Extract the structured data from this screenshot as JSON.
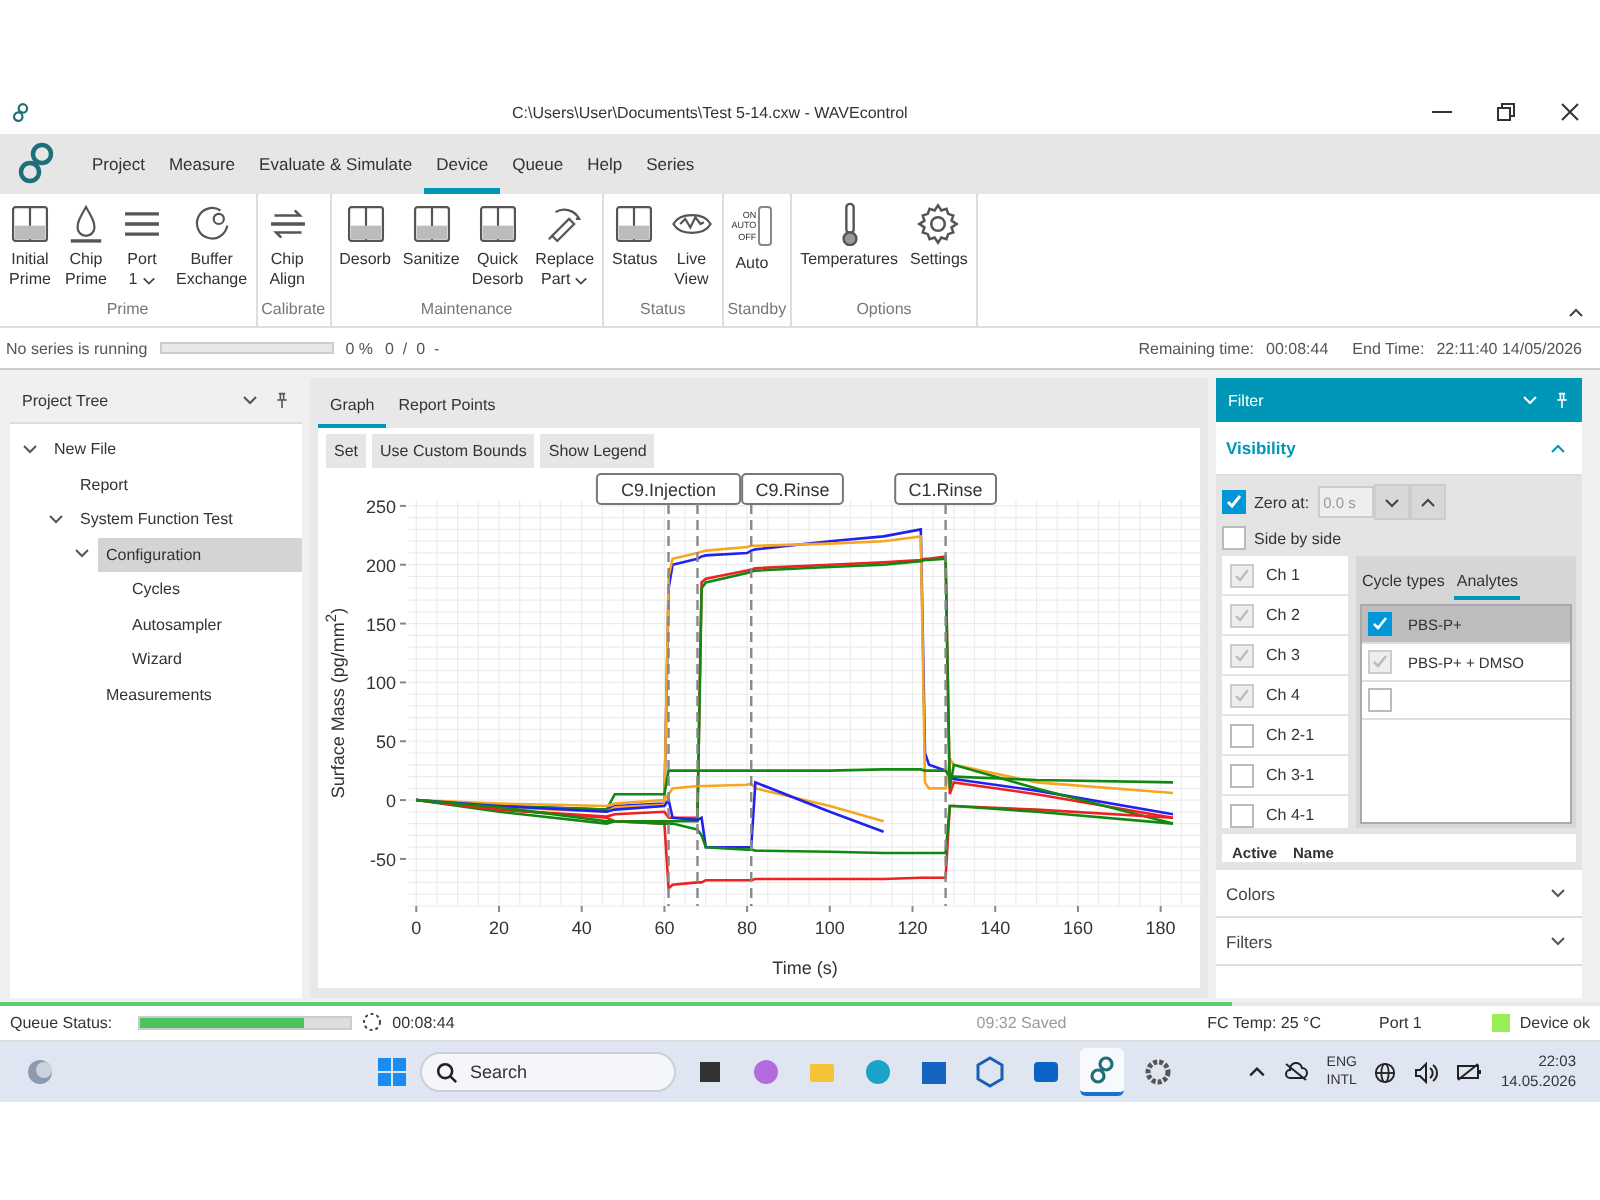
{
  "window": {
    "title": "C:\\Users\\User\\Documents\\Test 5-14.cxw - WAVEcontrol"
  },
  "menu": [
    {
      "label": "Project",
      "selected": false
    },
    {
      "label": "Measure",
      "selected": false
    },
    {
      "label": "Evaluate & Simulate",
      "selected": false
    },
    {
      "label": "Device",
      "selected": true
    },
    {
      "label": "Queue",
      "selected": false
    },
    {
      "label": "Help",
      "selected": false
    },
    {
      "label": "Series",
      "selected": false
    }
  ],
  "ribbon": [
    {
      "label": "Prime",
      "buttons": [
        {
          "kind": "icon",
          "lines": [
            "Initial",
            "Prime"
          ],
          "dropdown": false
        },
        {
          "kind": "icon",
          "lines": [
            "Chip",
            "Prime"
          ],
          "dropdown": false
        },
        {
          "kind": "icon",
          "lines": [
            "Port",
            "1"
          ],
          "dropdown": true
        },
        {
          "kind": "icon",
          "lines": [
            "Buffer",
            "Exchange"
          ],
          "dropdown": false
        }
      ]
    },
    {
      "label": "Calibrate",
      "buttons": [
        {
          "kind": "icon",
          "lines": [
            "Chip",
            "Align"
          ],
          "dropdown": false
        }
      ]
    },
    {
      "label": "Maintenance",
      "buttons": [
        {
          "kind": "icon",
          "lines": [
            "Desorb"
          ],
          "dropdown": false
        },
        {
          "kind": "icon",
          "lines": [
            "Sanitize"
          ],
          "dropdown": false
        },
        {
          "kind": "icon",
          "lines": [
            "Quick",
            "Desorb"
          ],
          "dropdown": false
        },
        {
          "kind": "icon",
          "lines": [
            "Replace",
            "Part"
          ],
          "dropdown": true
        }
      ]
    },
    {
      "label": "Status",
      "buttons": [
        {
          "kind": "icon",
          "lines": [
            "Status"
          ],
          "dropdown": false
        },
        {
          "kind": "icon",
          "lines": [
            "Live",
            "View"
          ],
          "dropdown": false
        }
      ]
    },
    {
      "label": "Standby",
      "buttons": [
        {
          "kind": "switch",
          "switch_labels": [
            "ON",
            "AUTO",
            "OFF"
          ],
          "lines": [
            "Auto"
          ],
          "dropdown": false
        }
      ]
    },
    {
      "label": "Options",
      "buttons": [
        {
          "kind": "icon",
          "lines": [
            "Temperatures"
          ],
          "dropdown": false
        },
        {
          "kind": "icon",
          "lines": [
            "Settings"
          ],
          "dropdown": false
        }
      ]
    }
  ],
  "progress": {
    "text": "No series is running",
    "level": 0,
    "percent": "0 %",
    "counter": "0  /  0  -",
    "remaining_label": "Remaining time:",
    "remaining": "00:08:44",
    "end_label": "End Time:",
    "end": "22:11:40 14/05/2026"
  },
  "tree": {
    "title": "Project Tree",
    "items": [
      {
        "label": "New File",
        "expanded": true,
        "selected": false,
        "children": [
          {
            "label": "Report",
            "selected": false
          },
          {
            "label": "System Function Test",
            "expanded": true,
            "selected": false,
            "children": [
              {
                "label": "Configuration",
                "expanded": true,
                "selected": true,
                "children": [
                  {
                    "label": "Cycles",
                    "selected": false
                  },
                  {
                    "label": "Autosampler",
                    "selected": false
                  },
                  {
                    "label": "Wizard",
                    "selected": false
                  }
                ]
              },
              {
                "label": "Measurements",
                "selected": false
              }
            ]
          }
        ]
      }
    ]
  },
  "graph": {
    "tabs": [
      {
        "label": "Graph",
        "selected": true
      },
      {
        "label": "Report Points",
        "selected": false
      }
    ],
    "buttons": [
      "Set",
      "Use Custom Bounds",
      "Show Legend"
    ],
    "chart_data": {
      "type": "line",
      "xlabel": "Time (s)",
      "ylabel": "Surface Mass (pg/mm$^{2}$)",
      "x": [
        0,
        20,
        46,
        48,
        60,
        61,
        62,
        68,
        69,
        70,
        80,
        81,
        82,
        100,
        113,
        122,
        123,
        124,
        128,
        129,
        130,
        150,
        183
      ],
      "series": [
        {
          "color": "#2222ee",
          "values": [
            0,
            -5,
            -8,
            -5,
            -3,
            180,
            200,
            205,
            207,
            208,
            210,
            212,
            213,
            220,
            224,
            230,
            40,
            30,
            25,
            20,
            18,
            8,
            -12
          ]
        },
        {
          "color": "#f5a623",
          "values": [
            0,
            -6,
            -10,
            -6,
            -4,
            190,
            205,
            210,
            211,
            212,
            215,
            216,
            216,
            218,
            220,
            224,
            15,
            10,
            10,
            35,
            30,
            15,
            6
          ]
        },
        {
          "color": "#ee2222",
          "values": [
            0,
            -8,
            -14,
            -12,
            -10,
            -15,
            -15,
            -15,
            185,
            188,
            195,
            196,
            197,
            200,
            202,
            204,
            205,
            205,
            207,
            5,
            15,
            5,
            -15
          ]
        },
        {
          "color": "#118811",
          "values": [
            0,
            -10,
            -20,
            -18,
            -18,
            -18,
            -18,
            -18,
            180,
            185,
            193,
            194,
            195,
            198,
            200,
            203,
            204,
            204,
            205,
            10,
            30,
            10,
            -20
          ]
        },
        {
          "color": "#118811",
          "values": [
            0,
            -5,
            -8,
            5,
            5,
            25,
            25,
            25,
            25,
            25,
            25,
            25,
            25,
            25,
            26,
            26,
            25,
            25,
            25,
            20,
            20,
            17,
            15
          ]
        },
        {
          "color": "#ee2222",
          "values": [
            0,
            -8,
            -15,
            -18,
            -20,
            -75,
            -72,
            -70,
            -70,
            -68,
            -68,
            -68,
            -67,
            -67,
            -67,
            -66,
            -66,
            -66,
            -66,
            -5,
            -5,
            -8,
            -15
          ]
        },
        {
          "color": "#f5a623",
          "values": [
            0,
            -3,
            -5,
            -3,
            0,
            5,
            10,
            12,
            12,
            12,
            13,
            14,
            10,
            -5,
            -18,
            null,
            null,
            null,
            null,
            null,
            null,
            null,
            null
          ]
        },
        {
          "color": "#2222ee",
          "values": [
            0,
            -5,
            -10,
            -8,
            -5,
            0,
            -15,
            -17,
            -15,
            -40,
            -40,
            -40,
            15,
            -10,
            -27,
            null,
            null,
            null,
            null,
            null,
            null,
            null,
            null
          ]
        },
        {
          "color": "#118811",
          "values": [
            0,
            -6,
            -18,
            -18,
            -20,
            -20,
            -20,
            -25,
            -30,
            -40,
            -42,
            -42,
            -43,
            -44,
            -45,
            -45,
            -45,
            -45,
            -45,
            -5,
            -5,
            -10,
            -20
          ]
        }
      ],
      "xlim": [
        -2,
        190
      ],
      "ylim": [
        -90,
        255
      ],
      "xticks": [
        0,
        20,
        40,
        60,
        80,
        100,
        120,
        140,
        160,
        180
      ],
      "yticks": [
        -50,
        0,
        50,
        100,
        150,
        200,
        250
      ],
      "grid": true,
      "ref_lines": [
        {
          "axis": "x",
          "value": 61,
          "label": "C9.Injection"
        },
        {
          "axis": "x",
          "value": 68
        },
        {
          "axis": "x",
          "value": 81,
          "label": "C9.Rinse"
        },
        {
          "axis": "x",
          "value": 128,
          "label": "C1.Rinse"
        }
      ]
    }
  },
  "filter": {
    "title": "Filter",
    "sections": [
      {
        "label": "Visibility",
        "expanded": true
      },
      {
        "label": "Colors",
        "expanded": false
      },
      {
        "label": "Filters",
        "expanded": false
      }
    ],
    "zero_at": {
      "label": "Zero at:",
      "checked": true,
      "value": "0.0 s"
    },
    "side_by_side": {
      "label": "Side by side",
      "checked": false
    },
    "channels": [
      {
        "label": "Ch 1",
        "checked": true,
        "disabled": true
      },
      {
        "label": "Ch 2",
        "checked": true,
        "disabled": true
      },
      {
        "label": "Ch 3",
        "checked": true,
        "disabled": true
      },
      {
        "label": "Ch 4",
        "checked": true,
        "disabled": true
      },
      {
        "label": "Ch 2-1",
        "checked": false,
        "disabled": false
      },
      {
        "label": "Ch 3-1",
        "checked": false,
        "disabled": false
      },
      {
        "label": "Ch 4-1",
        "checked": false,
        "disabled": false
      }
    ],
    "analyte_tabs": [
      {
        "label": "Cycle types",
        "selected": false
      },
      {
        "label": "Analytes",
        "selected": true
      }
    ],
    "analytes": [
      {
        "label": "PBS-P+",
        "checked": true,
        "disabled": false,
        "selected": true
      },
      {
        "label": "PBS-P+ + DMSO",
        "checked": true,
        "disabled": true,
        "selected": false
      },
      {
        "checked": false,
        "disabled": false,
        "selected": false
      }
    ],
    "columns": [
      "Active",
      "Name"
    ]
  },
  "status": {
    "overall": {
      "level": 0.77
    },
    "queue": {
      "label": "Queue Status:",
      "level": 0.78,
      "time": "00:08:44"
    },
    "saved": "09:32 Saved",
    "fc_temp": "FC Temp: 25 °C",
    "port": "Port 1",
    "device": {
      "label": "Device ok",
      "color": "#99ee55"
    }
  },
  "taskbar": {
    "search": {
      "placeholder": "Search"
    },
    "apps": [
      {
        "selected": false
      },
      {
        "selected": false
      },
      {
        "selected": false
      },
      {
        "selected": false
      },
      {
        "selected": false
      },
      {
        "selected": false
      },
      {
        "selected": false
      },
      {
        "selected": true
      },
      {
        "selected": false
      }
    ],
    "language": [
      "ENG",
      "INTL"
    ],
    "time": "22:03",
    "date": "14.05.2026"
  }
}
